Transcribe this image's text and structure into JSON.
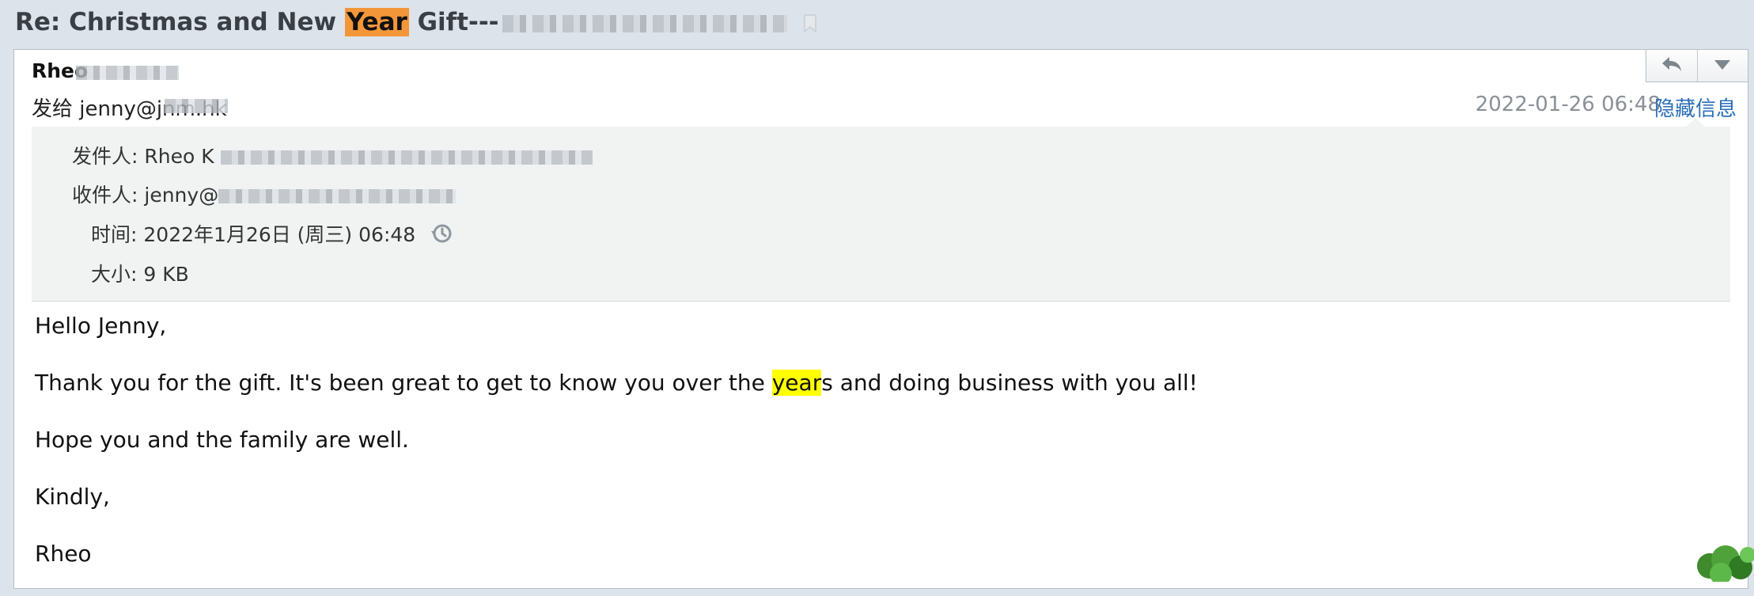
{
  "subject": {
    "prefix": "Re: Christmas and New ",
    "highlight": "Year",
    "suffix": " Gift---"
  },
  "header": {
    "sender_name": "Rheo",
    "send_to": "发给 jenny@jnm.hk",
    "date": "2022-01-26 06:48",
    "hide_info_label": "隐藏信息"
  },
  "details": {
    "from_label": "发件人:",
    "from_value": "Rheo K",
    "to_label": "收件人:",
    "to_value": "jenny@",
    "time_label": "时间:",
    "time_value": "2022年1月26日 (周三) 06:48",
    "size_label": "大小:",
    "size_value": "9 KB"
  },
  "body": {
    "greeting": "Hello Jenny,",
    "line1_before": "Thank you for the gift. It's been great to get to know you over the ",
    "line1_highlight": "year",
    "line1_after": "s and doing business with you all!",
    "line2": "Hope you and the family are well.",
    "closing": "Kindly,",
    "signature": "Rheo"
  },
  "colors": {
    "subject_highlight": "#f3963a",
    "search_highlight": "#ffff00",
    "link": "#2a6fb8",
    "background": "#dde3ea"
  },
  "icons": [
    "bookmark-icon",
    "reply-icon",
    "dropdown-icon",
    "history-icon"
  ]
}
